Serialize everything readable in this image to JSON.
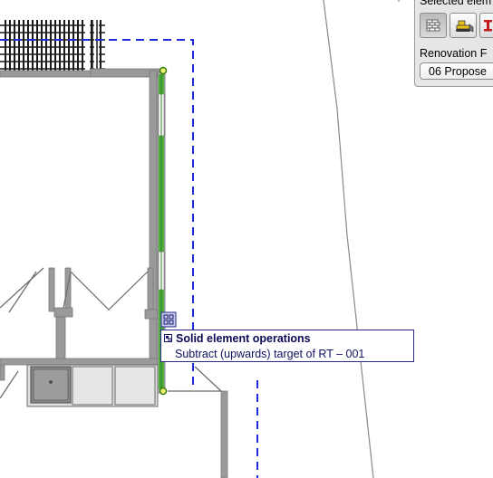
{
  "palette": {
    "title": "Selected elem",
    "renovation_label": "Renovation F",
    "renovation_value": "06 Propose",
    "buttons": [
      {
        "name": "wall-tool",
        "icon": "brick-wall-icon",
        "pressed": true
      },
      {
        "name": "demolish-tool",
        "icon": "bulldozer-icon",
        "pressed": false
      },
      {
        "name": "new-tool",
        "icon": "beam-icon",
        "pressed": false
      }
    ]
  },
  "tooltip": {
    "title": "Solid element operations",
    "subtitle": "Subtract (upwards) target of RT – 001"
  },
  "colors": {
    "selection": "#4caf3c",
    "wall": "#9a9a9a",
    "dash": "#1f2bd6",
    "tooltip_border": "#2a2a8a"
  }
}
